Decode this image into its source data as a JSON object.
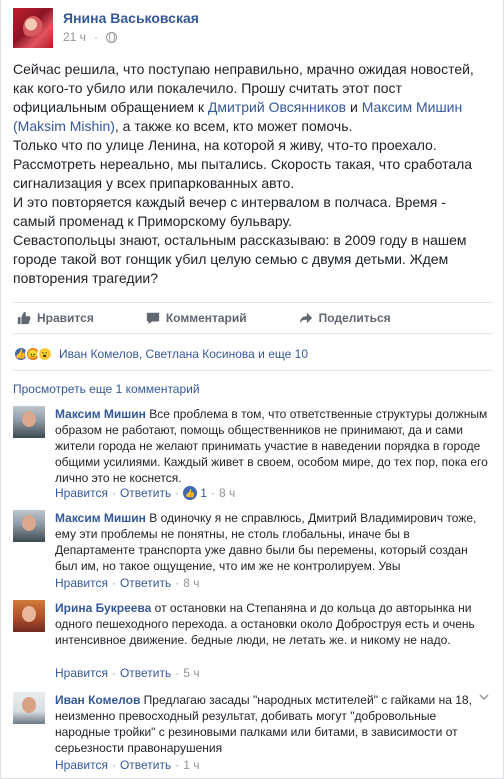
{
  "post": {
    "author": "Янина Васьковская",
    "time": "21 ч",
    "text_parts": [
      "Сейчас решила, что поступаю неправильно, мрачно ожидая новостей, как кого-то убило или покалечило. Прошу считать этот пост официальным обращением к ",
      "Дмитрий Овсянников",
      " и ",
      "Максим Мишин (Maksim Mishin)",
      ", а также ко всем, кто может помочь.",
      "Только что по улице Ленина, на которой я живу, что-то проехало. Рассмотреть нереально, мы пытались. Скорость такая, что сработала сигнализация у всех припаркованных авто.",
      "И это повторяется каждый вечер с интервалом в полчаса. Время - самый променад к Приморскому бульвару.",
      "Севастопольцы знают, остальным рассказываю: в 2009 году в нашем городе такой вот гонщик убил целую семью с двумя детьми. Ждем повторения трагедии?"
    ]
  },
  "actions": {
    "like": "Нравится",
    "comment": "Комментарий",
    "share": "Поделиться"
  },
  "reactions": {
    "names": "Иван Комелов, Светлана Косинова и еще 10"
  },
  "more_comments": "Просмотреть еще 1 комментарий",
  "comments": [
    {
      "name": "Максим Мишин",
      "text": "Все проблема в том, что ответственные структуры должным образом не работают, помощь общественников не принимают, да и сами жители города не желают принимать участие в наведении порядка в городе общими усилиями. Каждый живет в своем, особом мире, до тех пор, пока его лично это не коснется.",
      "like": "Нравится",
      "reply": "Ответить",
      "likes": "1",
      "time": "8 ч"
    },
    {
      "name": "Максим Мишин",
      "text": "В одиночку я не справлюсь, Дмитрий Владимирович тоже, ему эти проблемы не понятны, не столь глобальны, иначе бы в Департаменте транспорта уже давно были бы перемены, который создан был им, но такое ощущение, что им же не контролируем. Увы",
      "like": "Нравится",
      "reply": "Ответить",
      "time": "8 ч"
    },
    {
      "name": "Ирина Букреева",
      "text": "от остановки на Степаняна и до кольца до авторынка ни одного пешеходного перехода. а остановки около Доброструя есть и очень интенсивное движение. бедные люди, не летать же. и никому не надо.",
      "like": "Нравится",
      "reply": "Ответить",
      "time": "5 ч"
    },
    {
      "name": "Иван Комелов",
      "text": "Предлагаю засады \"народных мстителей\" с гайками на 18, неизменно превосходный результат, добивать могут \"добровольные народные тройки\" с резиновыми палками или битами, в зависимости от серьезности правонарушения",
      "like": "Нравится",
      "reply": "Ответить",
      "time": "1 ч"
    }
  ]
}
